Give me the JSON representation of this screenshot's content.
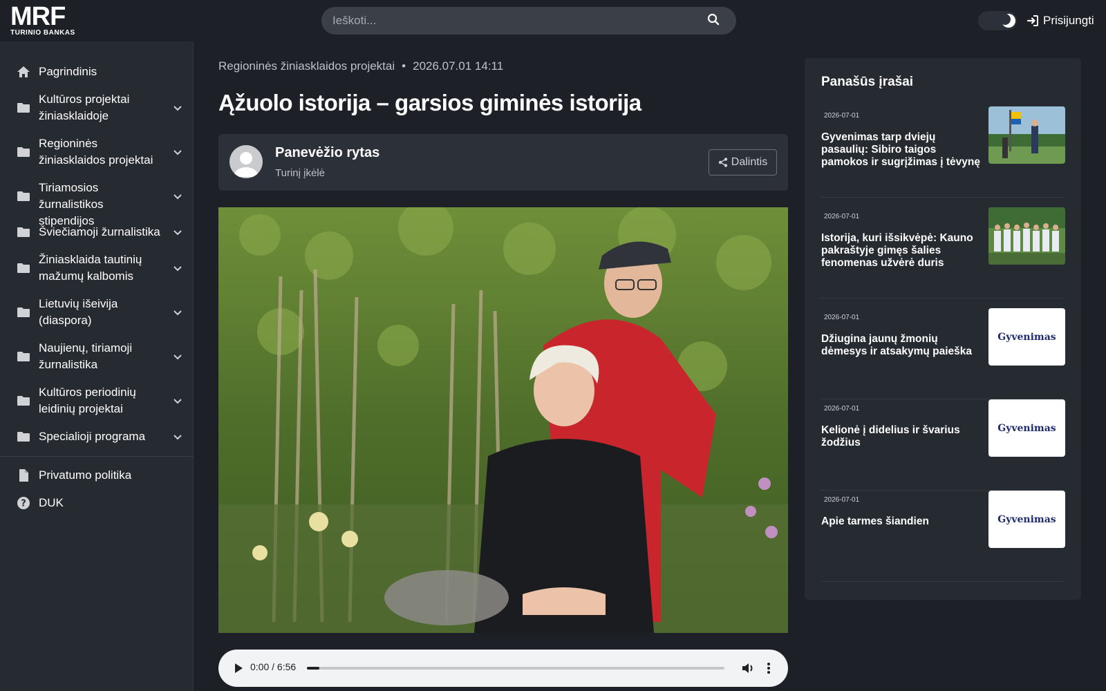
{
  "header": {
    "logo_main": "MRF",
    "logo_sub": "TURINIO BANKAS",
    "search_placeholder": "Ieškoti...",
    "login_label": "Prisijungti"
  },
  "sidebar": {
    "items": [
      {
        "label": "Pagrindinis",
        "icon": "home-icon"
      },
      {
        "label": "Kultūros projektai žiniasklaidoje",
        "icon": "folder-icon"
      },
      {
        "label": "Regioninės žiniasklaidos projektai",
        "icon": "folder-icon"
      },
      {
        "label": "Tiriamosios žurnalistikos stipendijos",
        "icon": "folder-icon"
      },
      {
        "label": "Šviečiamoji žurnalistika",
        "icon": "folder-icon"
      },
      {
        "label": "Žiniasklaida tautinių mažumų kalbomis",
        "icon": "folder-icon"
      },
      {
        "label": "Lietuvių išeivija (diaspora)",
        "icon": "folder-icon"
      },
      {
        "label": "Naujienų, tiriamoji žurnalistika",
        "icon": "folder-icon"
      },
      {
        "label": "Kultūros periodinių leidinių projektai",
        "icon": "folder-icon"
      },
      {
        "label": "Specialioji programa",
        "icon": "folder-icon"
      }
    ],
    "footer_items": [
      {
        "label": "Privatumo politika",
        "icon": "document-icon"
      },
      {
        "label": "DUK",
        "icon": "question-icon"
      }
    ]
  },
  "article": {
    "category": "Regioninės žiniasklaidos projektai",
    "separator": "•",
    "datetime": "2026.07.01 14:11",
    "title": "Ąžuolo istorija – garsios giminės istorija",
    "author_name": "Panevėžio rytas",
    "author_sub": "Turinį įkėlė",
    "share_label": "Dalintis"
  },
  "audio": {
    "time": "0:00 / 6:56",
    "progress": 0.03
  },
  "related": {
    "title": "Panašūs įrašai",
    "items": [
      {
        "date": "2026-07-01",
        "title": "Gyvenimas tarp dviejų pasaulių: Sibiro taigos pamokos ir sugrįžimas į tėvynę",
        "thumb": "photo-ceremony"
      },
      {
        "date": "2026-07-01",
        "title": "Istorija, kuri išsikvėpė: Kauno pakraštyje gimęs šalies fenomenas užvėrė duris",
        "thumb": "photo-group"
      },
      {
        "date": "2026-07-01",
        "title": "Džiugina jaunų žmonių dėmesys ir atsakymų paieška",
        "thumb": "Gyvenimas"
      },
      {
        "date": "2026-07-01",
        "title": "Kelionė į didelius ir švarius žodžius",
        "thumb": "Gyvenimas"
      },
      {
        "date": "2026-07-01",
        "title": "Apie tarmes šiandien",
        "thumb": "Gyvenimas"
      }
    ]
  }
}
